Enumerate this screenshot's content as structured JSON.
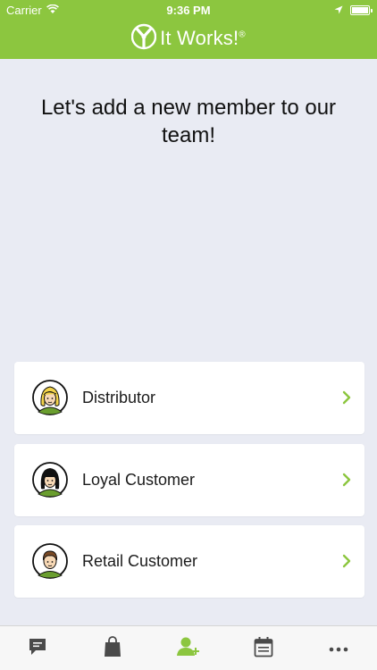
{
  "status_bar": {
    "carrier": "Carrier",
    "time": "9:36 PM",
    "icons": [
      "wifi-icon",
      "location-arrow-icon",
      "battery-icon"
    ]
  },
  "header": {
    "brand": "It Works!",
    "brand_mark": "®",
    "logo_icon": "it-works-logo-icon",
    "color": "#8cc63f"
  },
  "main": {
    "headline": "Let's add a new member to our team!",
    "options": [
      {
        "label": "Distributor",
        "avatar": "blonde-woman-avatar-icon"
      },
      {
        "label": "Loyal Customer",
        "avatar": "dark-hair-woman-avatar-icon"
      },
      {
        "label": "Retail Customer",
        "avatar": "man-avatar-icon"
      }
    ]
  },
  "tab_bar": {
    "items": [
      {
        "icon": "chat-icon",
        "active": false
      },
      {
        "icon": "shopping-bag-icon",
        "active": false
      },
      {
        "icon": "add-member-icon",
        "active": true
      },
      {
        "icon": "calendar-icon",
        "active": false
      },
      {
        "icon": "more-icon",
        "active": false
      }
    ],
    "active_color": "#8cc63f",
    "inactive_color": "#4a4a4a"
  }
}
